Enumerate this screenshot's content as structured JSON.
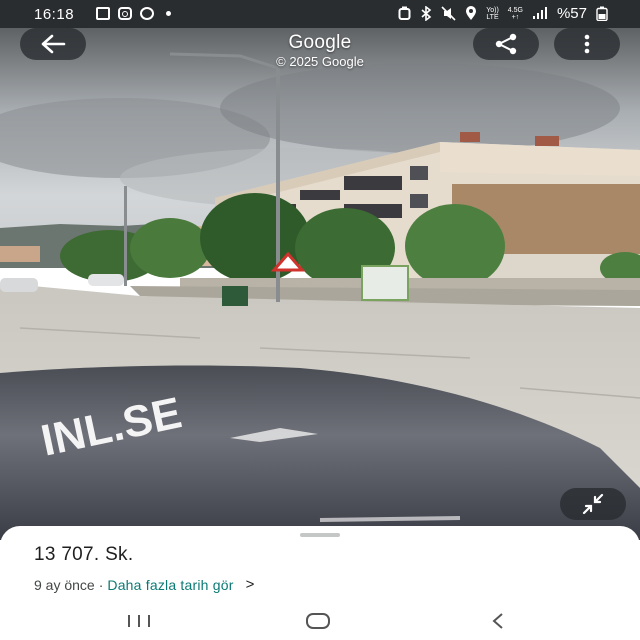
{
  "status_bar": {
    "time": "16:18",
    "network_label_top": "Yo))",
    "network_label_bottom": "LTE",
    "network_type_top": "4.5G",
    "network_type_bottom": "+↑",
    "battery": "%57",
    "left_icons": [
      "gallery-icon",
      "instagram-icon",
      "whatsapp-icon",
      "notification-dot-icon"
    ],
    "right_icons": [
      "alarm-icon",
      "bluetooth-icon",
      "mute-icon",
      "location-icon",
      "signal-icon",
      "battery-icon"
    ]
  },
  "street_view": {
    "title": "Google",
    "copyright": "© 2025 Google",
    "buttons": [
      "back-arrow-icon",
      "share-icon",
      "more-vertical-icon",
      "collapse-icon"
    ],
    "car_hood_text": "INL.SE"
  },
  "bottom_sheet": {
    "place_name": "13 707. Sk.",
    "date_text": "9 ay önce",
    "separator": "·",
    "history_link": "Daha fazla tarih gör",
    "chevron": ">"
  },
  "colors": {
    "accent_link": "#0b7a75",
    "status_bar": "#2a2d30",
    "overlay_button": "#282c30"
  },
  "nav_bar": {
    "icons": [
      "recents-icon",
      "home-icon",
      "back-icon"
    ]
  }
}
